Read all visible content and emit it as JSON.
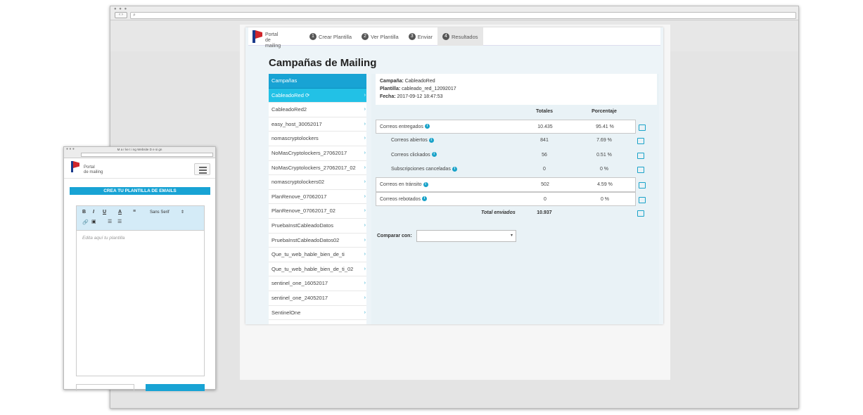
{
  "browser": {
    "dots": "● ● ●",
    "nav": "‹ ›",
    "url_icon": "⌕"
  },
  "app": {
    "logo_line1": "Portal",
    "logo_line2": "de mailing",
    "steps": [
      {
        "num": "1",
        "label": "Crear Plantilla"
      },
      {
        "num": "2",
        "label": "Ver Plantilla"
      },
      {
        "num": "3",
        "label": "Enviar"
      },
      {
        "num": "4",
        "label": "Resultados"
      }
    ],
    "page_title": "Campañas de Mailing",
    "campaign_list": {
      "header": "Campañas",
      "selected": "CableadoRed",
      "items": [
        "CableadoRed2",
        "easy_host_30052017",
        "nomascryptolockers",
        "NoMasCryptolockers_27062017",
        "NoMasCryptolockers_27062017_02",
        "nomascryptolockers02",
        "PlanRenove_07062017",
        "PlanRenove_07062017_02",
        "PruebaInstCableadoDatos",
        "PruebaInstCableadoDatos02",
        "Que_tu_web_hable_bien_de_ti",
        "Que_tu_web_hable_bien_de_ti_02",
        "sentinel_one_16052017",
        "sentinel_one_24052017",
        "SentinelOne"
      ]
    },
    "info": {
      "campaign_label": "Campaña:",
      "campaign_value": "CableadoRed",
      "template_label": "Plantilla:",
      "template_value": "cableado_red_12092017",
      "date_label": "Fecha:",
      "date_value": "2017-09-12 18:47:53"
    },
    "table": {
      "col_totals": "Totales",
      "col_percent": "Porcentaje",
      "rows": [
        {
          "label": "Correos entregados",
          "total": "10.435",
          "pct": "95.41 %"
        },
        {
          "label": "Correos abiertos",
          "total": "841",
          "pct": "7.69 %"
        },
        {
          "label": "Correos clickados",
          "total": "56",
          "pct": "0.51 %"
        },
        {
          "label": "Subscripciones canceladas",
          "total": "0",
          "pct": "0 %"
        },
        {
          "label": "Correos en tránsito",
          "total": "502",
          "pct": "4.59 %"
        },
        {
          "label": "Correos rebotados",
          "total": "0",
          "pct": "0 %"
        }
      ],
      "total_label": "Total enviados",
      "total_value": "10.937"
    },
    "compare_label": "Comparar con:",
    "compare_value": "▾"
  },
  "mini": {
    "window_title": "M a r ke t i ng Website D e si gn",
    "logo_line1": "Portal",
    "logo_line2": "de mailing",
    "create_button": "CREA TU PLANTILLA DE EMAILS",
    "toolbar": {
      "bold": "B",
      "italic": "I",
      "underline": "U",
      "color": "A",
      "align": "≡",
      "font": "Sans Serif",
      "font_arrow": "⇕",
      "link": "🔗",
      "image": "▣",
      "ol": "☰",
      "ul": "☰"
    },
    "placeholder": "Edita aquí tu plantilla"
  }
}
